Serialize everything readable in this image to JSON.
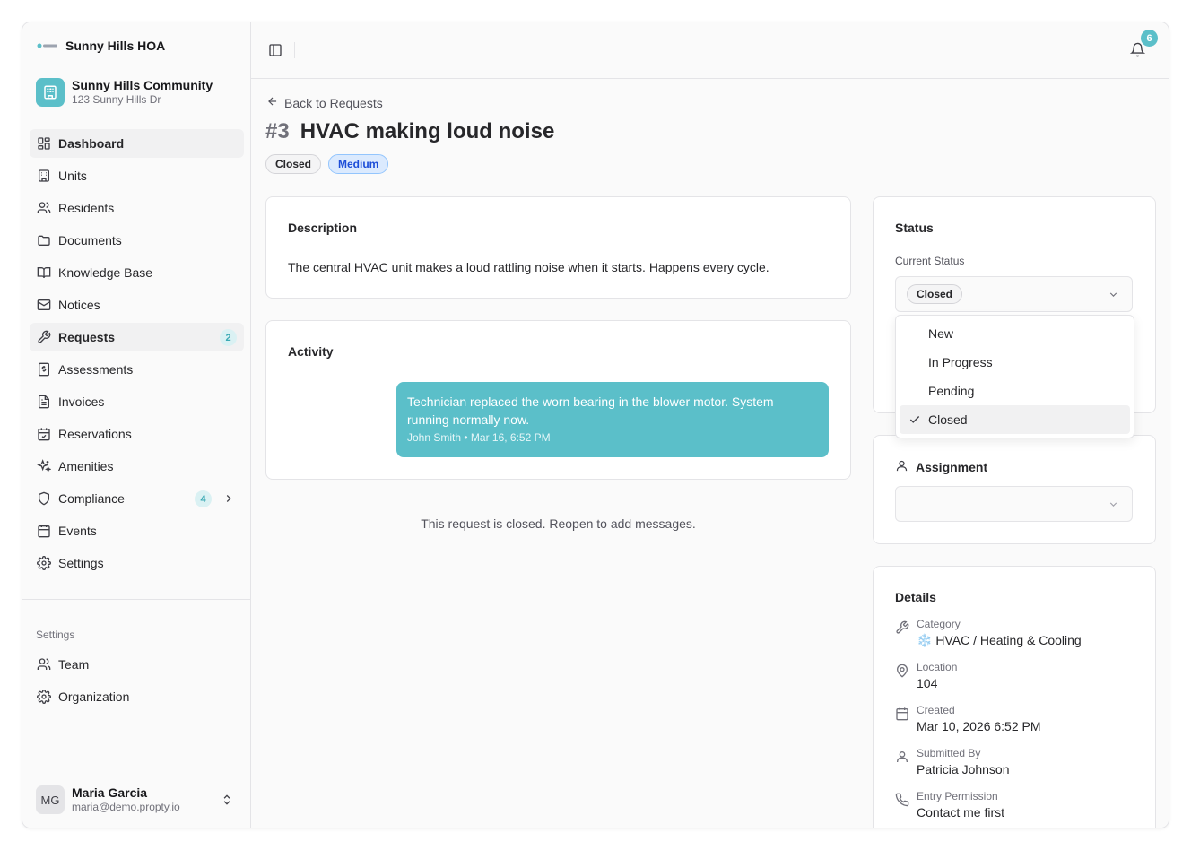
{
  "sidebar": {
    "brand_name": "Sunny Hills HOA",
    "org": {
      "name": "Sunny Hills Community",
      "address": "123 Sunny Hills Dr"
    },
    "nav": [
      {
        "label": "Dashboard",
        "icon": "dashboard-icon",
        "badge": ""
      },
      {
        "label": "Units",
        "icon": "building-icon",
        "badge": ""
      },
      {
        "label": "Residents",
        "icon": "users-icon",
        "badge": ""
      },
      {
        "label": "Documents",
        "icon": "folder-icon",
        "badge": ""
      },
      {
        "label": "Knowledge Base",
        "icon": "book-icon",
        "badge": ""
      },
      {
        "label": "Notices",
        "icon": "mail-icon",
        "badge": ""
      },
      {
        "label": "Requests",
        "icon": "wrench-icon",
        "badge": "2"
      },
      {
        "label": "Assessments",
        "icon": "dollar-receipt-icon",
        "badge": ""
      },
      {
        "label": "Invoices",
        "icon": "file-text-icon",
        "badge": ""
      },
      {
        "label": "Reservations",
        "icon": "calendar-check-icon",
        "badge": ""
      },
      {
        "label": "Amenities",
        "icon": "sparkles-icon",
        "badge": ""
      },
      {
        "label": "Compliance",
        "icon": "shield-icon",
        "badge": "4"
      },
      {
        "label": "Events",
        "icon": "calendar-icon",
        "badge": ""
      },
      {
        "label": "Settings",
        "icon": "gear-icon",
        "badge": ""
      }
    ],
    "settings_section": "Settings",
    "settings_nav": [
      {
        "label": "Team",
        "icon": "users-icon"
      },
      {
        "label": "Organization",
        "icon": "gear-icon"
      }
    ],
    "user": {
      "initials": "MG",
      "name": "Maria Garcia",
      "email": "maria@demo.propty.io"
    }
  },
  "topbar": {
    "notification_count": "6"
  },
  "request": {
    "back_label": "Back to Requests",
    "number": "#3",
    "title": "HVAC making loud noise",
    "status_badge": "Closed",
    "priority_badge": "Medium",
    "description_title": "Description",
    "description": "The central HVAC unit makes a loud rattling noise when it starts. Happens every cycle.",
    "activity_title": "Activity",
    "activity": [
      {
        "text": "Technician replaced the worn bearing in the blower motor. System running normally now.",
        "meta": "John Smith • Mar 16, 6:52 PM"
      }
    ],
    "closed_note": "This request is closed. Reopen to add messages."
  },
  "status_panel": {
    "title": "Status",
    "current_label": "Current Status",
    "current_value": "Closed",
    "options": [
      "New",
      "In Progress",
      "Pending",
      "Closed"
    ],
    "selected": "Closed"
  },
  "assignment": {
    "title": "Assignment",
    "value": ""
  },
  "details": {
    "title": "Details",
    "category_label": "Category",
    "category_value": "❄️ HVAC / Heating & Cooling",
    "location_label": "Location",
    "location_value": "104",
    "created_label": "Created",
    "created_value": "Mar 10, 2026 6:52 PM",
    "submitted_label": "Submitted By",
    "submitted_value": "Patricia Johnson",
    "entry_label": "Entry Permission",
    "entry_value": "Contact me first"
  },
  "colors": {
    "accent": "#5bbfc9",
    "medium_badge": "#dbeafe"
  }
}
